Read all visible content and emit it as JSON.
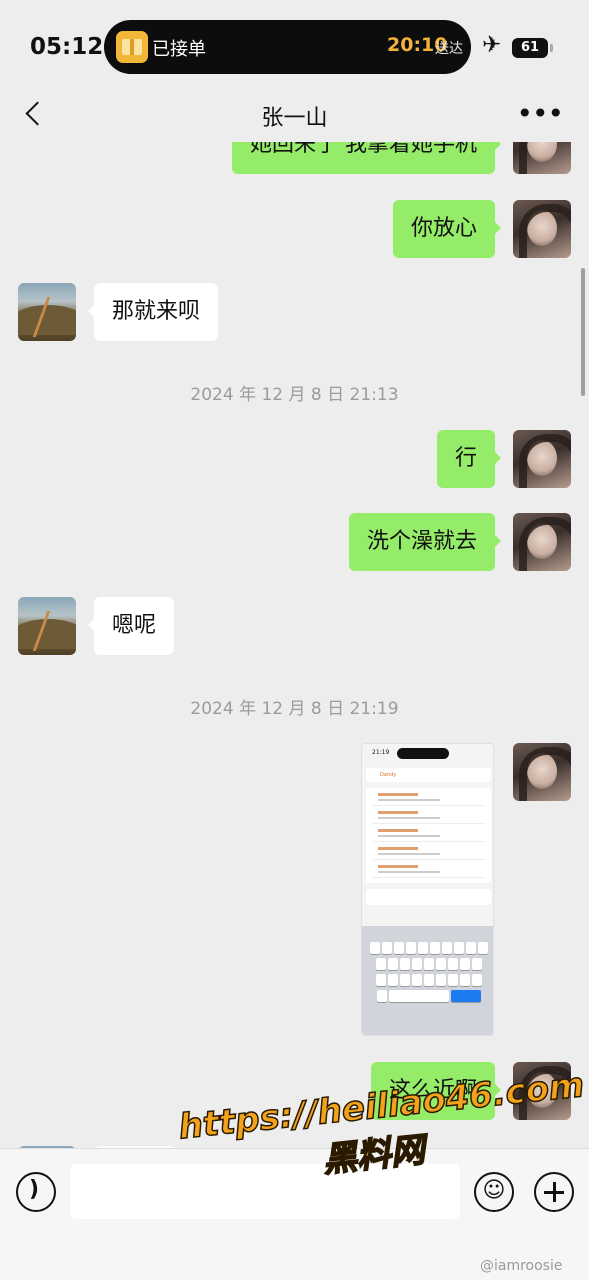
{
  "status_bar": {
    "time": "05:12",
    "island_label": "已接单",
    "island_time": "20:10",
    "island_sub": "送达",
    "battery": "61",
    "airplane_icon": "airplane-icon"
  },
  "nav": {
    "title": "张一山",
    "more": "•••"
  },
  "messages": [
    {
      "from": "me",
      "text": "她回来了 我拿着她手机"
    },
    {
      "from": "me",
      "text": "你放心"
    },
    {
      "from": "other",
      "text": "那就来呗"
    },
    {
      "type": "timestamp",
      "text": "2024 年 12 月 8 日 21:13"
    },
    {
      "from": "me",
      "text": "行"
    },
    {
      "from": "me",
      "text": "洗个澡就去"
    },
    {
      "from": "other",
      "text": "嗯呢"
    },
    {
      "type": "timestamp",
      "text": "2024 年 12 月 8 日 21:19"
    },
    {
      "from": "me",
      "type": "image",
      "text": "手机截图"
    },
    {
      "from": "me",
      "text": "这么近啊"
    }
  ],
  "screenshot": {
    "time": "21:19",
    "search_text": "Dandy"
  },
  "input_bar": {
    "emoji": "☺"
  },
  "watermark": {
    "url": "https://heiliao46.com",
    "name": "黑料网",
    "weibo": "@iamroosie"
  }
}
